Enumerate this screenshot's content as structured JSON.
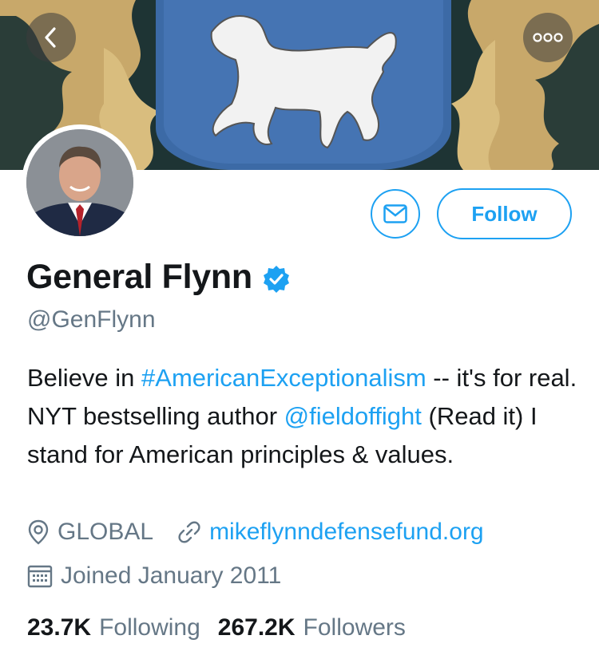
{
  "header": {
    "back_icon": "chevron-left-icon",
    "more_icon": "more-horizontal-icon"
  },
  "profile": {
    "name": "General Flynn",
    "handle": "@GenFlynn",
    "verified": true,
    "follow_label": "Follow",
    "bio": {
      "part1": "Believe in ",
      "hashtag": "#AmericanExceptionalism",
      "part2": " -- it's for real. NYT bestselling author ",
      "mention": "@fieldoffight",
      "part3": " (Read it) I stand for American principles & values."
    },
    "location": "GLOBAL",
    "website": "mikeflynndefensefund.org",
    "joined": "Joined January 2011",
    "following_count": "23.7K",
    "following_label": "Following",
    "followers_count": "267.2K",
    "followers_label": "Followers"
  },
  "colors": {
    "accent": "#1da1f2",
    "text": "#14171a",
    "secondary": "#657786"
  }
}
